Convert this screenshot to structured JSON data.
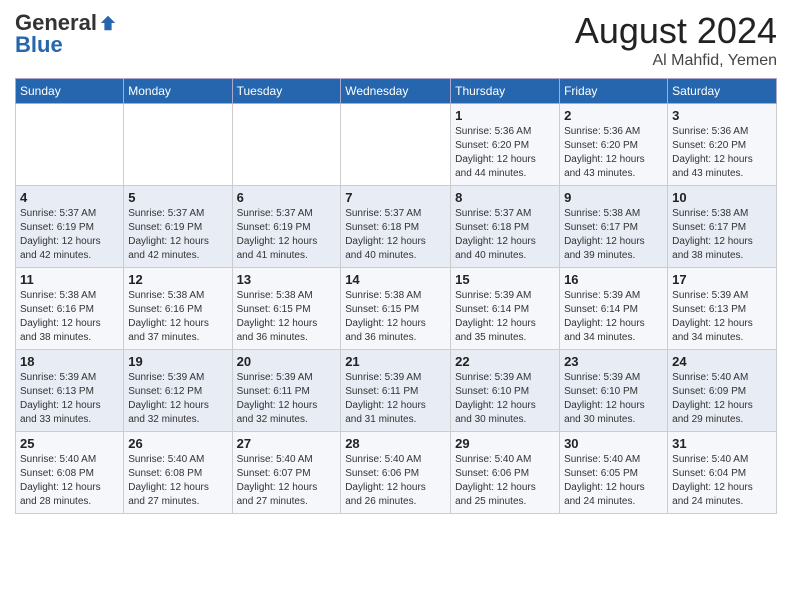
{
  "header": {
    "logo_general": "General",
    "logo_blue": "Blue",
    "month_year": "August 2024",
    "location": "Al Mahfid, Yemen"
  },
  "weekdays": [
    "Sunday",
    "Monday",
    "Tuesday",
    "Wednesday",
    "Thursday",
    "Friday",
    "Saturday"
  ],
  "weeks": [
    [
      {
        "day": "",
        "info": ""
      },
      {
        "day": "",
        "info": ""
      },
      {
        "day": "",
        "info": ""
      },
      {
        "day": "",
        "info": ""
      },
      {
        "day": "1",
        "info": "Sunrise: 5:36 AM\nSunset: 6:20 PM\nDaylight: 12 hours\nand 44 minutes."
      },
      {
        "day": "2",
        "info": "Sunrise: 5:36 AM\nSunset: 6:20 PM\nDaylight: 12 hours\nand 43 minutes."
      },
      {
        "day": "3",
        "info": "Sunrise: 5:36 AM\nSunset: 6:20 PM\nDaylight: 12 hours\nand 43 minutes."
      }
    ],
    [
      {
        "day": "4",
        "info": "Sunrise: 5:37 AM\nSunset: 6:19 PM\nDaylight: 12 hours\nand 42 minutes."
      },
      {
        "day": "5",
        "info": "Sunrise: 5:37 AM\nSunset: 6:19 PM\nDaylight: 12 hours\nand 42 minutes."
      },
      {
        "day": "6",
        "info": "Sunrise: 5:37 AM\nSunset: 6:19 PM\nDaylight: 12 hours\nand 41 minutes."
      },
      {
        "day": "7",
        "info": "Sunrise: 5:37 AM\nSunset: 6:18 PM\nDaylight: 12 hours\nand 40 minutes."
      },
      {
        "day": "8",
        "info": "Sunrise: 5:37 AM\nSunset: 6:18 PM\nDaylight: 12 hours\nand 40 minutes."
      },
      {
        "day": "9",
        "info": "Sunrise: 5:38 AM\nSunset: 6:17 PM\nDaylight: 12 hours\nand 39 minutes."
      },
      {
        "day": "10",
        "info": "Sunrise: 5:38 AM\nSunset: 6:17 PM\nDaylight: 12 hours\nand 38 minutes."
      }
    ],
    [
      {
        "day": "11",
        "info": "Sunrise: 5:38 AM\nSunset: 6:16 PM\nDaylight: 12 hours\nand 38 minutes."
      },
      {
        "day": "12",
        "info": "Sunrise: 5:38 AM\nSunset: 6:16 PM\nDaylight: 12 hours\nand 37 minutes."
      },
      {
        "day": "13",
        "info": "Sunrise: 5:38 AM\nSunset: 6:15 PM\nDaylight: 12 hours\nand 36 minutes."
      },
      {
        "day": "14",
        "info": "Sunrise: 5:38 AM\nSunset: 6:15 PM\nDaylight: 12 hours\nand 36 minutes."
      },
      {
        "day": "15",
        "info": "Sunrise: 5:39 AM\nSunset: 6:14 PM\nDaylight: 12 hours\nand 35 minutes."
      },
      {
        "day": "16",
        "info": "Sunrise: 5:39 AM\nSunset: 6:14 PM\nDaylight: 12 hours\nand 34 minutes."
      },
      {
        "day": "17",
        "info": "Sunrise: 5:39 AM\nSunset: 6:13 PM\nDaylight: 12 hours\nand 34 minutes."
      }
    ],
    [
      {
        "day": "18",
        "info": "Sunrise: 5:39 AM\nSunset: 6:13 PM\nDaylight: 12 hours\nand 33 minutes."
      },
      {
        "day": "19",
        "info": "Sunrise: 5:39 AM\nSunset: 6:12 PM\nDaylight: 12 hours\nand 32 minutes."
      },
      {
        "day": "20",
        "info": "Sunrise: 5:39 AM\nSunset: 6:11 PM\nDaylight: 12 hours\nand 32 minutes."
      },
      {
        "day": "21",
        "info": "Sunrise: 5:39 AM\nSunset: 6:11 PM\nDaylight: 12 hours\nand 31 minutes."
      },
      {
        "day": "22",
        "info": "Sunrise: 5:39 AM\nSunset: 6:10 PM\nDaylight: 12 hours\nand 30 minutes."
      },
      {
        "day": "23",
        "info": "Sunrise: 5:39 AM\nSunset: 6:10 PM\nDaylight: 12 hours\nand 30 minutes."
      },
      {
        "day": "24",
        "info": "Sunrise: 5:40 AM\nSunset: 6:09 PM\nDaylight: 12 hours\nand 29 minutes."
      }
    ],
    [
      {
        "day": "25",
        "info": "Sunrise: 5:40 AM\nSunset: 6:08 PM\nDaylight: 12 hours\nand 28 minutes."
      },
      {
        "day": "26",
        "info": "Sunrise: 5:40 AM\nSunset: 6:08 PM\nDaylight: 12 hours\nand 27 minutes."
      },
      {
        "day": "27",
        "info": "Sunrise: 5:40 AM\nSunset: 6:07 PM\nDaylight: 12 hours\nand 27 minutes."
      },
      {
        "day": "28",
        "info": "Sunrise: 5:40 AM\nSunset: 6:06 PM\nDaylight: 12 hours\nand 26 minutes."
      },
      {
        "day": "29",
        "info": "Sunrise: 5:40 AM\nSunset: 6:06 PM\nDaylight: 12 hours\nand 25 minutes."
      },
      {
        "day": "30",
        "info": "Sunrise: 5:40 AM\nSunset: 6:05 PM\nDaylight: 12 hours\nand 24 minutes."
      },
      {
        "day": "31",
        "info": "Sunrise: 5:40 AM\nSunset: 6:04 PM\nDaylight: 12 hours\nand 24 minutes."
      }
    ]
  ]
}
